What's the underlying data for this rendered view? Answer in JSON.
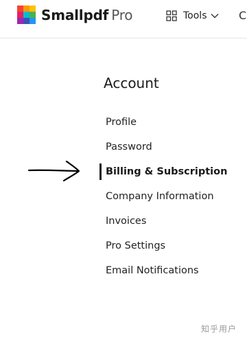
{
  "header": {
    "brand_name": "Smallpdf",
    "brand_tier": "Pro",
    "tools_label": "Tools",
    "edge_glyph": "C",
    "logo_colors": [
      "#f44336",
      "#ff9800",
      "#ffc107",
      "#e91e63",
      "#00bcd4",
      "#4caf50",
      "#9c27b0",
      "#3f51b5",
      "#2196f3"
    ]
  },
  "account": {
    "heading": "Account",
    "items": [
      {
        "label": "Profile",
        "active": false
      },
      {
        "label": "Password",
        "active": false
      },
      {
        "label": "Billing & Subscription",
        "active": true
      },
      {
        "label": "Company Information",
        "active": false
      },
      {
        "label": "Invoices",
        "active": false
      },
      {
        "label": "Pro Settings",
        "active": false
      },
      {
        "label": "Email Notifications",
        "active": false
      }
    ]
  },
  "watermark": "知乎用户",
  "colors": {
    "text": "#1f1f1f",
    "border": "#e6e6e6",
    "watermark": "#9a9a9a"
  }
}
